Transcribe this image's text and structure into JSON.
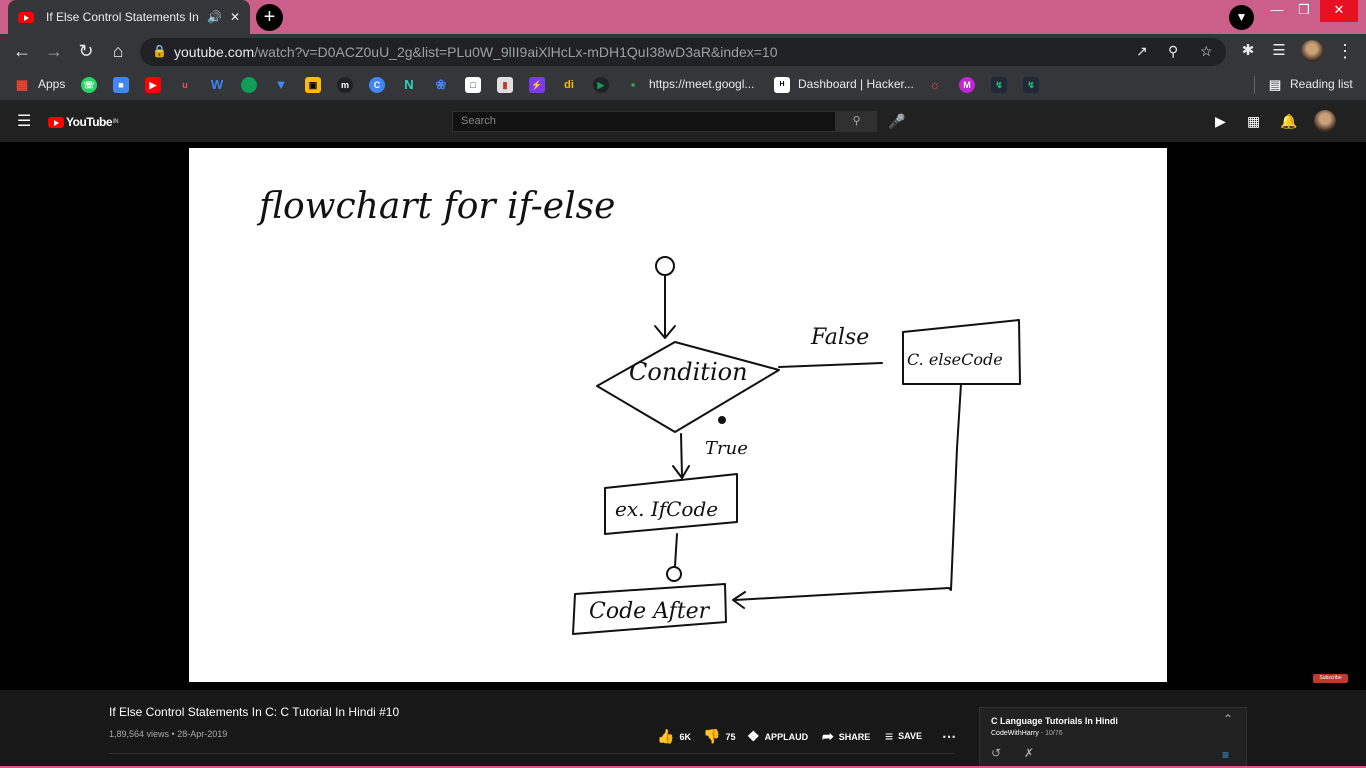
{
  "browser": {
    "tab_title": "If Else Control Statements In C: C Tutorial In Hindi #10",
    "url_host": "youtube.com",
    "url_path": "/watch?v=D0ACZ0uU_2g&list=PLu0W_9lII9aiXlHcLx-mDH1QuI38wD3aR&index=10",
    "colors": {
      "titlebar": "#cc5e8a",
      "toolbar": "#35363a"
    }
  },
  "bookmarks": {
    "apps_label": "Apps",
    "meet_label": "https://meet.googl...",
    "dashboard_label": "Dashboard | Hacker...",
    "reading_list_label": "Reading list"
  },
  "youtube": {
    "logo_text": "YouTube",
    "country": "IN",
    "search_placeholder": "Search"
  },
  "slide": {
    "heading": "flowchart for if-else",
    "condition": "Condition",
    "false_label": "False",
    "true_label": "True",
    "else_box": "C. elseCode",
    "if_box": "ex. IfCode",
    "after_box": "Code After"
  },
  "video": {
    "title": "If Else Control Statements In C: C Tutorial In Hindi #10",
    "views_date": "1,89,564 views • 28-Apr-2019",
    "likes": "6K",
    "dislikes": "75",
    "applaud": "APPLAUD",
    "share": "SHARE",
    "save": "SAVE",
    "subscribe_watermark": "Subscribe"
  },
  "playlist": {
    "title": "C Language Tutorials In Hindi",
    "channel": "CodeWithHarry",
    "position": "10/76"
  }
}
